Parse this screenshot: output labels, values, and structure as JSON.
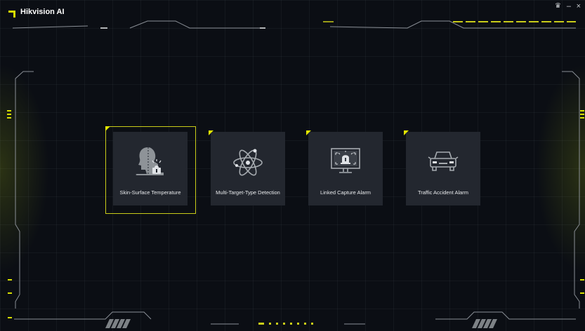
{
  "window": {
    "title": "Hikvision AI",
    "controls": {
      "skin": "♛",
      "minimize": "–",
      "close": "×"
    }
  },
  "colors": {
    "accent": "#d8e000",
    "card_bg": "#23272f",
    "bg": "#0b0e14"
  },
  "cards": [
    {
      "label": "Skin-Surface Temperature",
      "icon": "person-temperature-icon",
      "selected": true
    },
    {
      "label": "Multi-Target-Type Detection",
      "icon": "atom-icon",
      "selected": false
    },
    {
      "label": "Linked Capture Alarm",
      "icon": "alarm-monitor-icon",
      "selected": false
    },
    {
      "label": "Traffic Accident Alarm",
      "icon": "car-icon",
      "selected": false
    }
  ],
  "pager": {
    "count": 8,
    "active": 0
  }
}
